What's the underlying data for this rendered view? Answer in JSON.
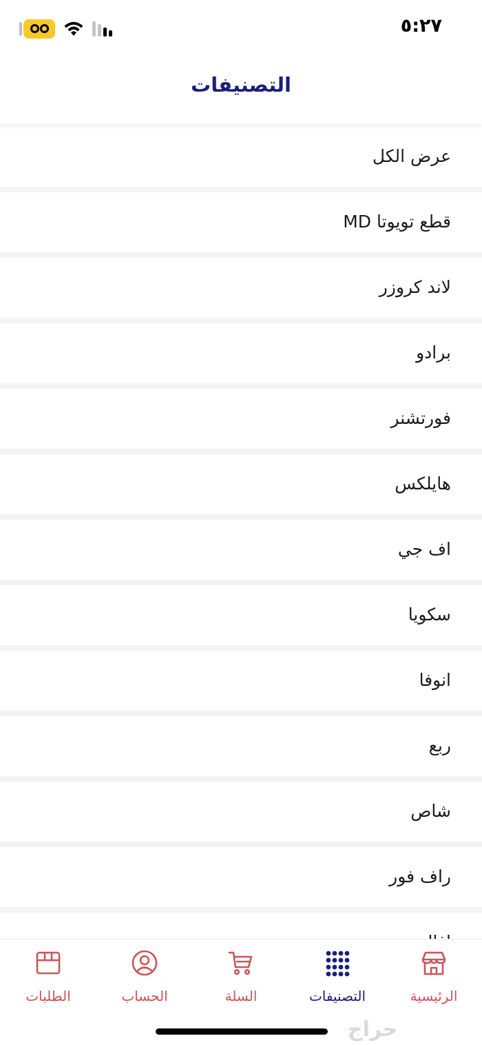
{
  "status_bar": {
    "time": "٥:٢٧",
    "icons": [
      "eyes-badge-icon",
      "wifi-icon",
      "cellular-signal-icon"
    ]
  },
  "header": {
    "title": "التصنيفات"
  },
  "categories": [
    {
      "label": "عرض الكل"
    },
    {
      "label": "قطع تويوتا MD"
    },
    {
      "label": "لاند كروزر"
    },
    {
      "label": "برادو"
    },
    {
      "label": "فورتشنر"
    },
    {
      "label": "هايلكس"
    },
    {
      "label": "اف جي"
    },
    {
      "label": "سكويا"
    },
    {
      "label": "انوفا"
    },
    {
      "label": "ربع"
    },
    {
      "label": "شاص"
    },
    {
      "label": "راف فور"
    },
    {
      "label": "افالون"
    }
  ],
  "bottom_nav": {
    "items": [
      {
        "label": "الرئيسية",
        "icon": "store-icon",
        "active": false
      },
      {
        "label": "التصنيفات",
        "icon": "grid-dots-icon",
        "active": true
      },
      {
        "label": "السلة",
        "icon": "cart-icon",
        "active": false
      },
      {
        "label": "الحساب",
        "icon": "user-circle-icon",
        "active": false
      },
      {
        "label": "الطلبات",
        "icon": "box-icon",
        "active": false
      }
    ]
  },
  "watermark": "حراج",
  "colors": {
    "title": "#1b1f7a",
    "nav_active": "#1b1f7a",
    "nav_inactive": "#c9555a",
    "list_divider": "#f3f3f5"
  }
}
